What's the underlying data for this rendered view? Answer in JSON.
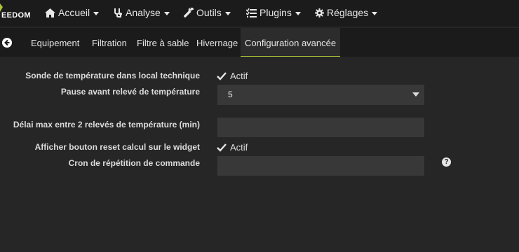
{
  "brand": {
    "logo_text": "EEDOM",
    "accent": "#a8c736"
  },
  "nav": {
    "items": [
      {
        "label": "Accueil",
        "icon": "home-icon"
      },
      {
        "label": "Analyse",
        "icon": "stethoscope-icon"
      },
      {
        "label": "Outils",
        "icon": "wrench-icon"
      },
      {
        "label": "Plugins",
        "icon": "tasks-icon"
      },
      {
        "label": "Réglages",
        "icon": "gear-icon"
      }
    ]
  },
  "tabs": {
    "back_icon": "back-arrow-icon",
    "items": [
      {
        "label": "Equipement",
        "active": false
      },
      {
        "label": "Filtration",
        "active": false
      },
      {
        "label": "Filtre à sable",
        "active": false
      },
      {
        "label": "Hivernage",
        "active": false
      },
      {
        "label": "Configuration avancée",
        "active": true
      }
    ]
  },
  "form": {
    "sonde": {
      "label": "Sonde de température dans local technique",
      "checkbox_label": "Actif",
      "checked": true
    },
    "pause": {
      "label": "Pause avant relevé de température",
      "value": "5"
    },
    "delai": {
      "label": "Délai max entre 2 relevés de température (min)",
      "value": ""
    },
    "reset": {
      "label": "Afficher bouton reset calcul sur le widget",
      "checkbox_label": "Actif",
      "checked": true
    },
    "cron": {
      "label": "Cron de répétition de commande",
      "value": "",
      "help_icon": "question-circle-icon"
    }
  }
}
